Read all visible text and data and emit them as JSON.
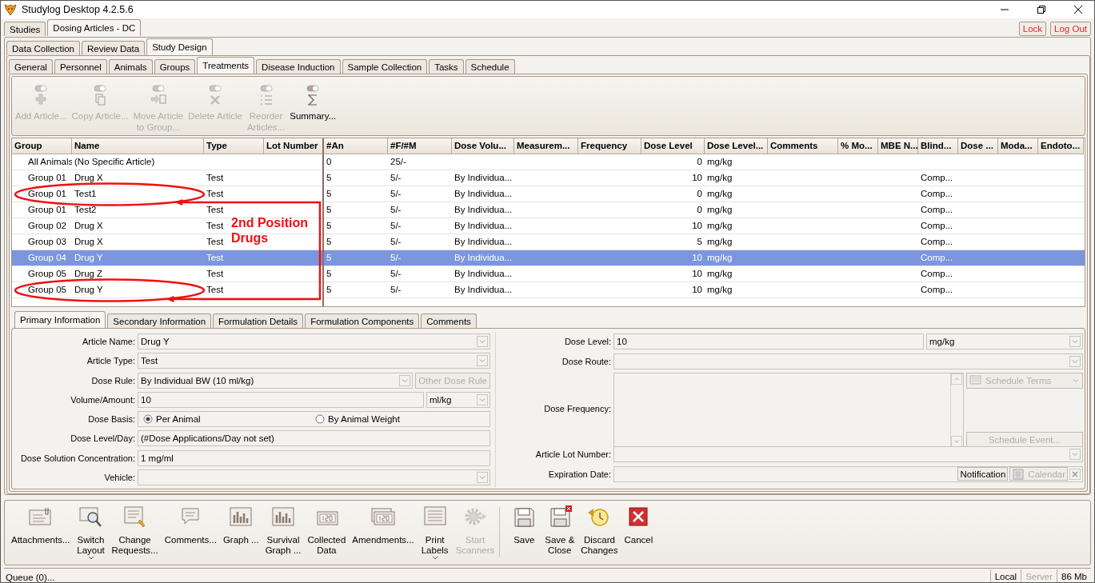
{
  "window": {
    "title": "Studylog Desktop 4.2.5.6"
  },
  "top_tabs": [
    {
      "label": "Studies",
      "selected": false
    },
    {
      "label": "Dosing Articles - DC",
      "selected": true
    }
  ],
  "session_buttons": [
    "Lock",
    "Log Out"
  ],
  "view_tabs": [
    {
      "label": "Data Collection",
      "selected": false
    },
    {
      "label": "Review Data",
      "selected": false
    },
    {
      "label": "Study Design",
      "selected": true
    }
  ],
  "design_tabs": [
    {
      "label": "General",
      "selected": false
    },
    {
      "label": "Personnel",
      "selected": false
    },
    {
      "label": "Animals",
      "selected": false
    },
    {
      "label": "Groups",
      "selected": false
    },
    {
      "label": "Treatments",
      "selected": true
    },
    {
      "label": "Disease Induction",
      "selected": false
    },
    {
      "label": "Sample Collection",
      "selected": false
    },
    {
      "label": "Tasks",
      "selected": false
    },
    {
      "label": "Schedule",
      "selected": false
    }
  ],
  "toolbar": [
    {
      "label": "Add Article...",
      "disabled": true
    },
    {
      "label": "Copy Article...",
      "disabled": true
    },
    {
      "label": "Move Article\nto Group...",
      "disabled": true
    },
    {
      "label": "Delete Article",
      "disabled": true
    },
    {
      "label": "Reorder\nArticles...",
      "disabled": true
    },
    {
      "label": "Summary...",
      "disabled": false
    }
  ],
  "grid": {
    "columns": [
      "Group",
      "Name",
      "Type",
      "Lot Number",
      "#An",
      "#F/#M",
      "Dose Volu...",
      "Measurem...",
      "Frequency",
      "Dose Level",
      "Dose Level...",
      "Comments",
      "% Mo...",
      "MBE N...",
      "Blind...",
      "Dose ...",
      "Moda...",
      "Endoto..."
    ],
    "rows": [
      {
        "group": "All Animals",
        "name": "(No Specific Article)",
        "an": "0",
        "f_m": "25/-",
        "dose_level": "0",
        "dose_level_unit": "mg/kg",
        "selected": false,
        "circled": false
      },
      {
        "group": "Group 01",
        "name": "Drug X",
        "type": "Test",
        "an": "5",
        "f_m": "5/-",
        "dose_volume": "By Individua...",
        "dose_level": "10",
        "dose_level_unit": "mg/kg",
        "blind": "Comp...",
        "selected": false,
        "circled": false
      },
      {
        "group": "Group 01",
        "name": "Test1",
        "type": "Test",
        "an": "5",
        "f_m": "5/-",
        "dose_volume": "By Individua...",
        "dose_level": "0",
        "dose_level_unit": "mg/kg",
        "blind": "Comp...",
        "selected": false,
        "circled": true
      },
      {
        "group": "Group 01",
        "name": "Test2",
        "type": "Test",
        "an": "5",
        "f_m": "5/-",
        "dose_volume": "By Individua...",
        "dose_level": "0",
        "dose_level_unit": "mg/kg",
        "blind": "Comp...",
        "selected": false,
        "circled": false
      },
      {
        "group": "Group 02",
        "name": "Drug X",
        "type": "Test",
        "an": "5",
        "f_m": "5/-",
        "dose_volume": "By Individua...",
        "dose_level": "10",
        "dose_level_unit": "mg/kg",
        "blind": "Comp...",
        "selected": false,
        "circled": false
      },
      {
        "group": "Group 03",
        "name": "Drug X",
        "type": "Test",
        "an": "5",
        "f_m": "5/-",
        "dose_volume": "By Individua...",
        "dose_level": "5",
        "dose_level_unit": "mg/kg",
        "blind": "Comp...",
        "selected": false,
        "circled": false
      },
      {
        "group": "Group 04",
        "name": "Drug Y",
        "type": "Test",
        "an": "5",
        "f_m": "5/-",
        "dose_volume": "By Individua...",
        "dose_level": "10",
        "dose_level_unit": "mg/kg",
        "blind": "Comp...",
        "selected": true,
        "circled": false
      },
      {
        "group": "Group 05",
        "name": "Drug Z",
        "type": "Test",
        "an": "5",
        "f_m": "5/-",
        "dose_volume": "By Individua...",
        "dose_level": "10",
        "dose_level_unit": "mg/kg",
        "blind": "Comp...",
        "selected": false,
        "circled": false
      },
      {
        "group": "Group 05",
        "name": "Drug Y",
        "type": "Test",
        "an": "5",
        "f_m": "5/-",
        "dose_volume": "By Individua...",
        "dose_level": "10",
        "dose_level_unit": "mg/kg",
        "blind": "Comp...",
        "selected": false,
        "circled": true
      }
    ]
  },
  "annotation": {
    "text": "2nd Position Drugs"
  },
  "detail_tabs": [
    {
      "label": "Primary Information",
      "selected": true
    },
    {
      "label": "Secondary Information",
      "selected": false
    },
    {
      "label": "Formulation Details",
      "selected": false
    },
    {
      "label": "Formulation Components",
      "selected": false
    },
    {
      "label": "Comments",
      "selected": false
    }
  ],
  "form_left": [
    {
      "label": "Article Name:",
      "kind": "select",
      "value": "Drug Y"
    },
    {
      "label": "Article Type:",
      "kind": "select",
      "value": "Test"
    },
    {
      "label": "Dose Rule:",
      "kind": "select_button",
      "value": "By Individual BW (10 ml/kg)",
      "buttons": [
        {
          "label": "Other Dose Rule",
          "disabled": true
        }
      ]
    },
    {
      "label": "Volume/Amount:",
      "kind": "amount",
      "value": "10",
      "unit": "ml/kg"
    },
    {
      "label": "Dose Basis:",
      "kind": "radio",
      "options": [
        {
          "label": "Per Animal",
          "selected": true
        },
        {
          "label": "By Animal Weight",
          "selected": false
        }
      ]
    },
    {
      "label": "Dose Level/Day:",
      "kind": "text",
      "value": "(#Dose Applications/Day not set)"
    },
    {
      "label": "Dose Solution Concentration:",
      "kind": "text",
      "value": "1 mg/ml"
    },
    {
      "label": "Vehicle:",
      "kind": "select"
    }
  ],
  "form_right": [
    {
      "label": "Dose Level:",
      "kind": "amount",
      "value": "10",
      "unit": "mg/kg"
    },
    {
      "label": "Dose Route:",
      "kind": "select"
    },
    {
      "label": "Dose Frequency:",
      "kind": "memo",
      "buttons": [
        {
          "label": "Schedule Terms",
          "disabled": true
        },
        {
          "label": "Schedule Event...",
          "disabled": true
        }
      ]
    },
    {
      "label": "Article Lot Number:",
      "kind": "select"
    },
    {
      "label": "Expiration Date:",
      "kind": "date",
      "buttons": [
        {
          "label": "Notification",
          "disabled": false
        },
        {
          "label": "Calendar",
          "disabled": true
        }
      ]
    }
  ],
  "bottom_toolbar": [
    [
      {
        "label": "Attachments...",
        "disabled": false,
        "dropdown": false
      },
      {
        "label": "Switch\nLayout",
        "disabled": false,
        "dropdown": true
      },
      {
        "label": "Change\nRequests...",
        "disabled": false,
        "dropdown": false
      },
      {
        "label": "Comments...",
        "disabled": false,
        "dropdown": false
      },
      {
        "label": "Graph ...",
        "disabled": false,
        "dropdown": false
      },
      {
        "label": "Survival\nGraph ...",
        "disabled": false,
        "dropdown": false
      },
      {
        "label": "Collected\nData",
        "disabled": false,
        "dropdown": false
      },
      {
        "label": "Amendments...",
        "disabled": false,
        "dropdown": false
      },
      {
        "label": "Print\nLabels",
        "disabled": false,
        "dropdown": true
      },
      {
        "label": "Start\nScanners",
        "disabled": true,
        "dropdown": false
      }
    ],
    [
      {
        "label": "Save",
        "disabled": false,
        "dropdown": false
      },
      {
        "label": "Save &\nClose",
        "disabled": false,
        "dropdown": false
      },
      {
        "label": "Discard\nChanges",
        "disabled": false,
        "dropdown": false
      },
      {
        "label": "Cancel",
        "disabled": false,
        "dropdown": false
      }
    ]
  ],
  "status_bar": {
    "queue": "Queue (0)...",
    "connection": [
      {
        "label": "Local",
        "active": true
      },
      {
        "label": "Server",
        "active": false
      }
    ],
    "memory": "86 Mb"
  }
}
